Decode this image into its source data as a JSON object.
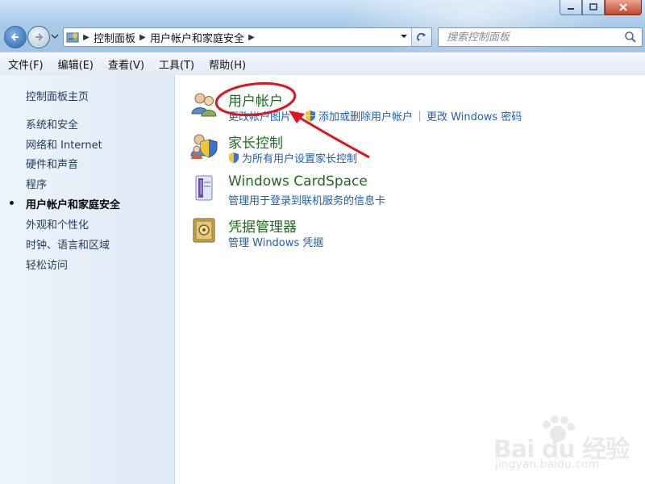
{
  "window": {
    "minimize_icon": "minimize-icon",
    "maximize_icon": "maximize-icon",
    "close_icon": "close-icon"
  },
  "address": {
    "crumbs": [
      "控制面板",
      "用户帐户和家庭安全"
    ],
    "search_placeholder": "搜索控制面板"
  },
  "menu": [
    "文件(F)",
    "编辑(E)",
    "查看(V)",
    "工具(T)",
    "帮助(H)"
  ],
  "sidebar": {
    "home": "控制面板主页",
    "items": [
      {
        "label": "系统和安全"
      },
      {
        "label": "网络和 Internet"
      },
      {
        "label": "硬件和声音"
      },
      {
        "label": "程序"
      },
      {
        "label": "用户帐户和家庭安全",
        "active": true
      },
      {
        "label": "外观和个性化"
      },
      {
        "label": "时钟、语言和区域"
      },
      {
        "label": "轻松访问"
      }
    ]
  },
  "categories": [
    {
      "title": "用户帐户",
      "icon": "users-icon",
      "links": [
        "更改帐户图片",
        "添加或删除用户帐户",
        "更改 Windows 密码"
      ]
    },
    {
      "title": "家长控制",
      "icon": "parental-control-icon",
      "links": [
        "为所有用户设置家长控制"
      ]
    },
    {
      "title": "Windows CardSpace",
      "icon": "cardspace-icon",
      "links": [
        "管理用于登录到联机服务的信息卡"
      ]
    },
    {
      "title": "凭据管理器",
      "icon": "credential-manager-icon",
      "links": [
        "管理 Windows 凭据"
      ]
    }
  ],
  "watermark": {
    "brand": "Bai du 经验",
    "url": "jingyan.baidu.com"
  },
  "colors": {
    "category_title": "#1e6b1e",
    "link": "#1d5fb5",
    "annotation": "#d9171c"
  }
}
